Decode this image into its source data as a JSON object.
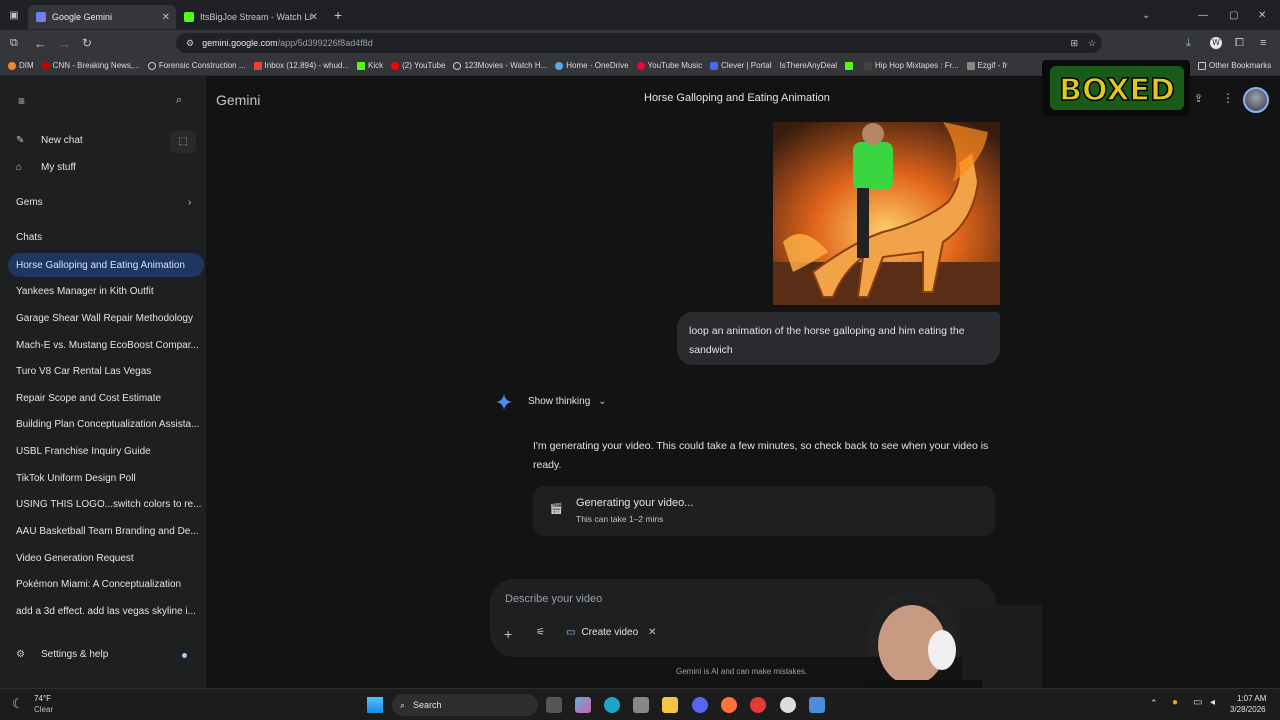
{
  "browser": {
    "tabs": [
      {
        "title": "Google Gemini",
        "active": true
      },
      {
        "title": "ItsBigJoe Stream - Watch Live o",
        "active": false
      }
    ],
    "url_host": "gemini.google.com",
    "url_path": "/app/5d399226f8ad4f8d",
    "bookmarks": [
      "DIM",
      "CNN - Breaking News,...",
      "Forensic Construction ...",
      "Inbox (12,894) - whud...",
      "Kick",
      "(2) YouTube",
      "123Movies - Watch H...",
      "Home - OneDrive",
      "YouTube Music",
      "Clever | Portal",
      "IsThereAnyDeal",
      "",
      "Hip Hop Mixtapes : Fr...",
      "Ezgif - fr"
    ],
    "other_bookmarks": "Other Bookmarks"
  },
  "sidebar": {
    "new_chat": "New chat",
    "my_stuff": "My stuff",
    "gems": "Gems",
    "chats_header": "Chats",
    "chats": [
      "Horse Galloping and Eating Animation",
      "Yankees Manager in Kith Outfit",
      "Garage Shear Wall Repair Methodology",
      "Mach-E vs. Mustang EcoBoost Compar...",
      "Turo V8 Car Rental Las Vegas",
      "Repair Scope and Cost Estimate",
      "Building Plan Conceptualization Assista...",
      "USBL Franchise Inquiry Guide",
      "TikTok Uniform Design Poll",
      "USING THIS LOGO...switch colors to re...",
      "AAU Basketball Team Branding and De...",
      "Video Generation Request",
      "Pokémon Miami: A Conceptualization",
      "add a 3d effect. add las vegas skyline i..."
    ],
    "settings": "Settings & help"
  },
  "header": {
    "app_name": "Gemini",
    "conversation_title": "Horse Galloping and Eating Animation"
  },
  "conversation": {
    "user_message": "loop an animation of the horse galloping and him eating the sandwich",
    "show_thinking": "Show thinking",
    "response": "I'm generating your video. This could take a few minutes, so check back to see when your video is ready.",
    "gen_title": "Generating your video...",
    "gen_subtitle": "This can take 1–2 mins"
  },
  "composer": {
    "placeholder": "Describe your video",
    "tool_chip": "Create video",
    "disclaimer": "Gemini is AI and can make mistakes."
  },
  "taskbar": {
    "weather_temp": "74°F",
    "weather_desc": "Clear",
    "search": "Search",
    "time": "1:07 AM",
    "date": "3/28/2026"
  },
  "overlay_logo_text": "BOXED",
  "colors": {
    "accent": "#1f3760",
    "sparkle": "#4e8cf5",
    "brand_green": "#53fc18"
  }
}
